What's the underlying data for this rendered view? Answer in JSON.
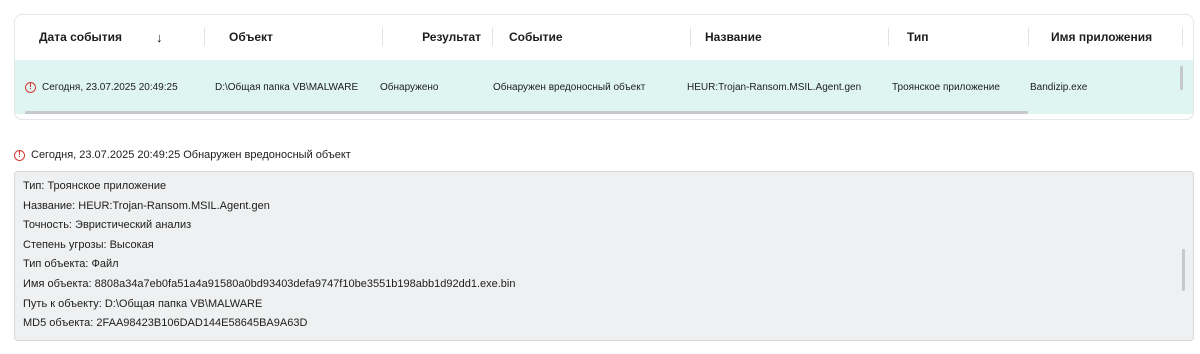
{
  "table": {
    "columns": [
      {
        "label": "Дата события"
      },
      {
        "label": "Объект"
      },
      {
        "label": "Результат"
      },
      {
        "label": "Событие"
      },
      {
        "label": "Название"
      },
      {
        "label": "Тип"
      },
      {
        "label": "Имя приложения"
      }
    ],
    "sort_icon": "↓",
    "rows": [
      {
        "date": "Сегодня, 23.07.2025 20:49:25",
        "object": "D:\\Общая папка VB\\MALWARE",
        "result": "Обнаружено",
        "event": "Обнаружен вредоносный объект",
        "name": "HEUR:Trojan-Ransom.MSIL.Agent.gen",
        "type": "Троянское приложение",
        "app": "Bandizip.exe"
      }
    ]
  },
  "detail": {
    "header": "Сегодня, 23.07.2025 20:49:25 Обнаружен вредоносный объект",
    "lines": [
      "Тип: Троянское приложение",
      "Название: HEUR:Trojan-Ransom.MSIL.Agent.gen",
      "Точность: Эвристический анализ",
      "Степень угрозы: Высокая",
      "Тип объекта: Файл",
      "Имя объекта: 8808a34a7eb0fa51a4a91580a0bd93403defa9747f10be3551b198abb1d92dd1.exe.bin",
      "Путь к объекту: D:\\Общая папка VB\\MALWARE",
      "MD5 объекта: 2FAA98423B106DAD144E58645BA9A63D"
    ]
  },
  "colors": {
    "selected_row": "#dff5f2",
    "alert": "#d43a32",
    "detail_bg": "#eef0f1"
  },
  "icons": {
    "alert": "alert-circle-icon",
    "sort": "arrow-down-icon"
  }
}
